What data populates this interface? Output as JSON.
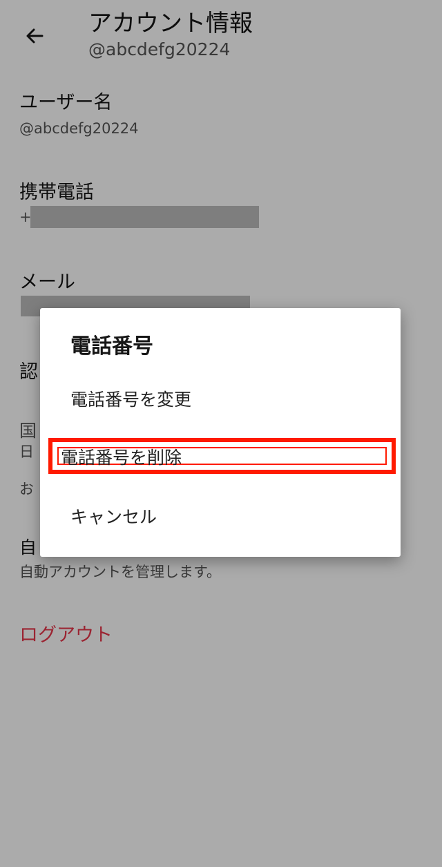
{
  "colors": {
    "accent_red": "#ff1a00",
    "logout_red": "#e8364b"
  },
  "header": {
    "back_icon": "arrow-left-icon",
    "title": "アカウント情報",
    "subtitle": "@abcdefg20224"
  },
  "settings": {
    "username": {
      "label": "ユーザー名",
      "value": "@abcdefg20224"
    },
    "phone": {
      "label": "携帯電話",
      "value_prefix": "+"
    },
    "email": {
      "label": "メール"
    },
    "partial_rows": {
      "auth_label": "認",
      "country_label": "国",
      "country_value": "日",
      "note": "お",
      "auto_label": "自",
      "auto_desc": "自動アカウントを管理します。"
    },
    "logout_label": "ログアウト"
  },
  "dialog": {
    "title": "電話番号",
    "options": [
      {
        "label": "電話番号を変更"
      },
      {
        "label": "電話番号を削除",
        "highlighted": true
      },
      {
        "label": "キャンセル"
      }
    ]
  }
}
